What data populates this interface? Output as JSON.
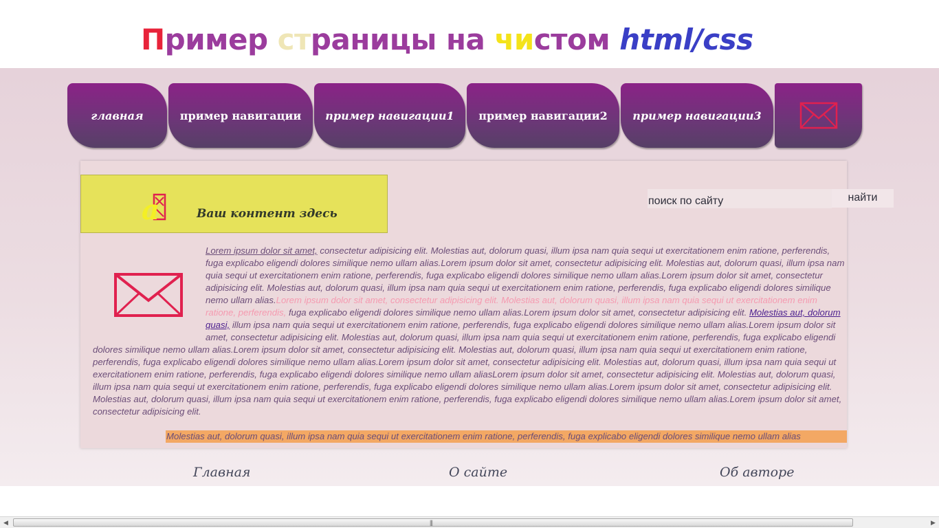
{
  "header": {
    "title_parts": [
      "П",
      "ример ",
      "ст",
      "раницы на ",
      "чи",
      "стом ",
      "html/css"
    ]
  },
  "nav": {
    "tabs": [
      {
        "label": "главная"
      },
      {
        "label": "пример навигации"
      },
      {
        "label": "пример навигации1"
      },
      {
        "label": "пример навигации2"
      },
      {
        "label": "пример навигации3"
      }
    ],
    "mail_icon": "envelope-icon"
  },
  "banner": {
    "text": "Ваш контент здесь",
    "logo_icon": "site-logo-icon"
  },
  "search": {
    "placeholder": "поиск по сайту",
    "button_label": "найти"
  },
  "article": {
    "link1": "Lorem ipsum dolor sit amet,",
    "part1": " consectetur adipisicing elit. Molestias aut, dolorum quasi, illum ipsa nam quia sequi ut exercitationem enim ratione, perferendis, fuga explicabo eligendi dolores similique nemo ullam alias.Lorem ipsum dolor sit amet, consectetur adipisicing elit. Molestias aut, dolorum quasi, illum ipsa nam quia sequi ut exercitationem enim ratione, perferendis, fuga explicabo eligendi dolores similique nemo ullam alias.Lorem ipsum dolor sit amet, consectetur adipisicing elit. Molestias aut, dolorum quasi, illum ipsa nam quia sequi ut exercitationem enim ratione, perferendis, fuga explicabo eligendi dolores similique nemo ullam alias.",
    "faint": "Lorem ipsum dolor sit amet, consectetur adipisicing elit. Molestias aut, dolorum quasi, illum ipsa nam quia sequi ut exercitationem enim ratione, perferendis,",
    "part2": " fuga explicabo eligendi dolores similique nemo ullam alias.Lorem ipsum dolor sit amet, consectetur adipisicing elit. ",
    "link2": "Molestias aut, dolorum quasi,",
    "part3": " illum ipsa nam quia sequi ut exercitationem enim ratione, perferendis, fuga explicabo eligendi dolores similique nemo ullam alias.Lorem ipsum dolor sit amet, consectetur adipisicing elit. Molestias aut, dolorum quasi, illum ipsa nam quia sequi ut exercitationem enim ratione, perferendis, fuga explicabo eligendi dolores similique nemo ullam alias.Lorem ipsum dolor sit amet, consectetur adipisicing elit. Molestias aut, dolorum quasi, illum ipsa nam quia sequi ut exercitationem enim ratione, perferendis, fuga explicabo eligendi dolores similique nemo ullam alias.Lorem ipsum dolor sit amet, consectetur adipisicing elit. Molestias aut, dolorum quasi, illum ipsa nam quia sequi ut exercitationem enim ratione, perferendis, fuga explicabo eligendi dolores similique nemo ullam aliasLorem ipsum dolor sit amet, consectetur adipisicing elit. Molestias aut, dolorum quasi, illum ipsa nam quia sequi ut exercitationem enim ratione, perferendis, fuga explicabo eligendi dolores similique nemo ullam alias.Lorem ipsum dolor sit amet, consectetur adipisicing elit. Molestias aut, dolorum quasi, illum ipsa nam quia sequi ut exercitationem enim ratione, perferendis, fuga explicabo eligendi dolores similique nemo ullam alias.Lorem ipsum dolor sit amet, consectetur adipisicing elit.",
    "highlight": "Molestias aut, dolorum quasi, illum ipsa nam quia sequi ut exercitationem enim ratione, perferendis, fuga explicabo eligendi dolores similique nemo ullam alias",
    "image_icon": "envelope-icon"
  },
  "footer": {
    "links": [
      "Главная",
      "О сайте",
      "Об авторе"
    ]
  },
  "colors": {
    "nav_top": "#8b2287",
    "nav_bottom": "#564066",
    "envelope": "#e0214f",
    "banner": "#e6e25a",
    "highlight": "#f3a864"
  }
}
